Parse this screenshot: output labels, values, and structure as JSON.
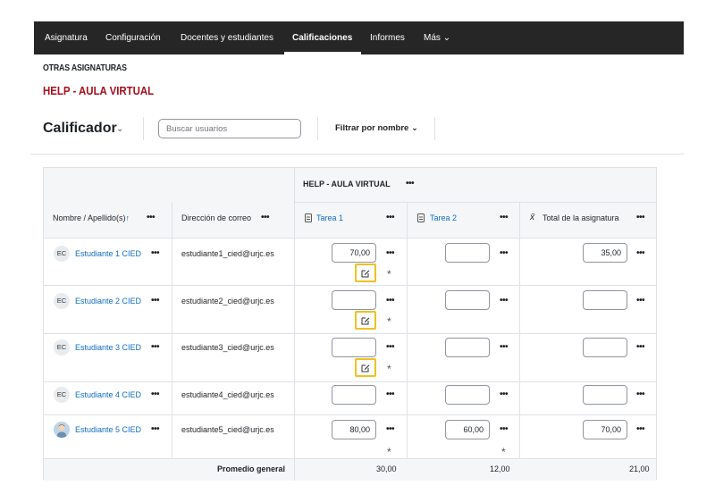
{
  "nav": {
    "tabs": [
      "Asignatura",
      "Configuración",
      "Docentes y estudiantes",
      "Calificaciones",
      "Informes",
      "Más"
    ],
    "active_tab": "Calificaciones",
    "more_caret": "⌄"
  },
  "breadcrumb": {
    "parent": "OTRAS ASIGNATURAS",
    "course": "HELP - AULA VIRTUAL"
  },
  "toolbar": {
    "title": "Calificador",
    "title_caret": "⌄",
    "search_placeholder": "Buscar usuarios",
    "filter_label": "Filtrar por nombre",
    "filter_caret": "⌄"
  },
  "table": {
    "category_header": "HELP - AULA VIRTUAL",
    "columns": {
      "name": "Nombre / Apellido(s)",
      "sort_indicator": "↑",
      "email": "Dirección de correo",
      "tarea1": "Tarea 1",
      "tarea2": "Tarea 2",
      "total": "Total de la asignatura",
      "total_symbol": "x̄"
    },
    "menu_glyph": "•••",
    "rows": [
      {
        "initials": "EC",
        "name": "Estudiante 1 CIED",
        "email": "estudiante1_cied@urjc.es",
        "tarea1": "70,00",
        "tarea2": "",
        "total": "35,00",
        "override": true,
        "star1": "*",
        "star2": ""
      },
      {
        "initials": "EC",
        "name": "Estudiante 2 CIED",
        "email": "estudiante2_cied@urjc.es",
        "tarea1": "",
        "tarea2": "",
        "total": "",
        "override": true,
        "star1": "*",
        "star2": ""
      },
      {
        "initials": "EC",
        "name": "Estudiante 3 CIED",
        "email": "estudiante3_cied@urjc.es",
        "tarea1": "",
        "tarea2": "",
        "total": "",
        "override": true,
        "star1": "*",
        "star2": ""
      },
      {
        "initials": "EC",
        "name": "Estudiante 4 CIED",
        "email": "estudiante4_cied@urjc.es",
        "tarea1": "",
        "tarea2": "",
        "total": "",
        "override": false,
        "star1": "",
        "star2": ""
      },
      {
        "initials": "",
        "name": "Estudiante 5 CIED",
        "email": "estudiante5_cied@urjc.es",
        "tarea1": "80,00",
        "tarea2": "60,00",
        "total": "70,00",
        "override": false,
        "star1": "*",
        "star2": "*"
      }
    ],
    "footer": {
      "label": "Promedio general",
      "tarea1": "30,00",
      "tarea2": "12,00",
      "total": "21,00"
    }
  },
  "colors": {
    "nav_bg": "#262626",
    "course_red": "#a30f1f",
    "link_blue": "#0f6cbf",
    "override_border": "#f0c020"
  }
}
